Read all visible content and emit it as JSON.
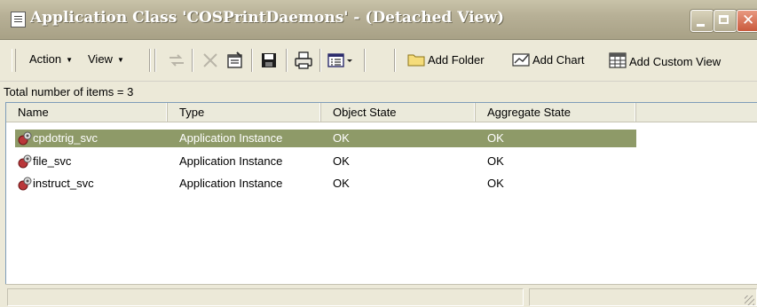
{
  "window": {
    "title": "Application Class 'COSPrintDaemons' - (Detached View)",
    "controls": {
      "minimize_icon": "minimize-icon",
      "maximize_icon": "maximize-icon",
      "close_icon": "close-icon",
      "close_glyph": "✕"
    },
    "accent_title_color": "#b7b096",
    "selection_color": "#8e9a68"
  },
  "toolbar": {
    "action_label": "Action",
    "view_label": "View",
    "add_folder_label": "Add Folder",
    "add_chart_label": "Add Chart",
    "add_custom_view_label": "Add Custom View",
    "icons": [
      "link-icon",
      "delete-icon",
      "properties-icon",
      "save-icon",
      "print-icon",
      "view-options-icon"
    ]
  },
  "summary": {
    "count_text": "Total number of items = 3"
  },
  "list": {
    "columns": [
      "Name",
      "Type",
      "Object State",
      "Aggregate State"
    ],
    "rows": [
      {
        "name": "cpdotrig_svc",
        "type": "Application Instance",
        "object_state": "OK",
        "aggregate_state": "OK",
        "selected": true
      },
      {
        "name": "file_svc",
        "type": "Application Instance",
        "object_state": "OK",
        "aggregate_state": "OK",
        "selected": false
      },
      {
        "name": "instruct_svc",
        "type": "Application Instance",
        "object_state": "OK",
        "aggregate_state": "OK",
        "selected": false
      }
    ]
  }
}
